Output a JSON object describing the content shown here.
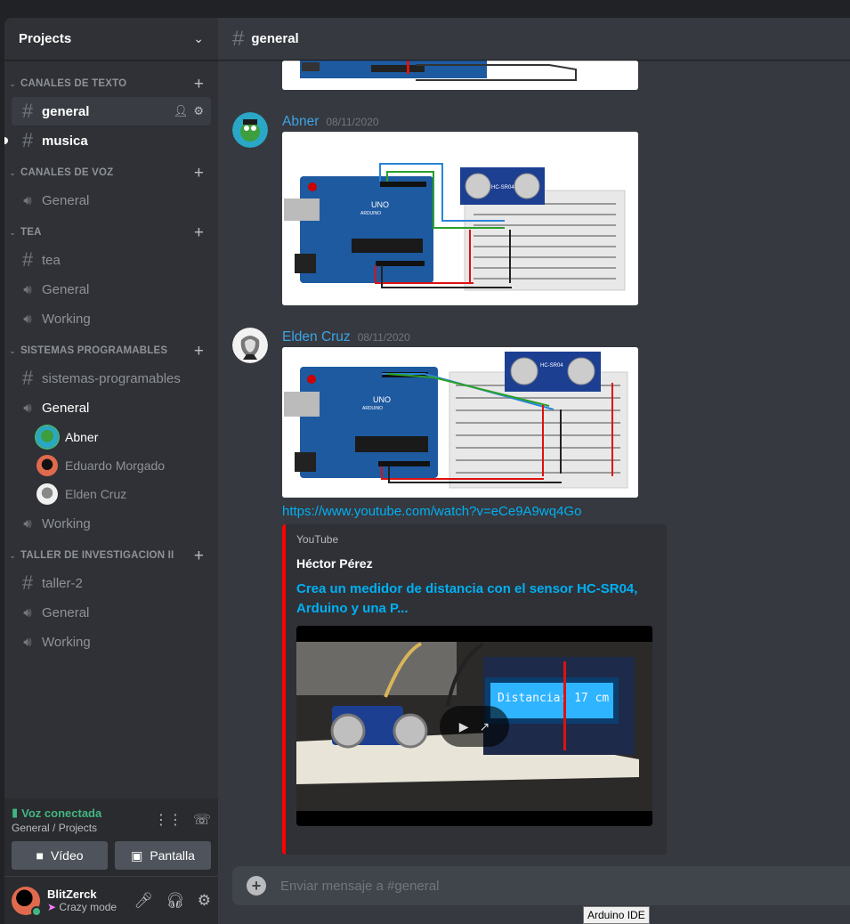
{
  "server": {
    "name": "Projects"
  },
  "categories": [
    {
      "label": "CANALES DE TEXTO",
      "channels": [
        {
          "name": "general",
          "type": "text",
          "state": "active"
        },
        {
          "name": "musica",
          "type": "text",
          "state": "unread"
        }
      ]
    },
    {
      "label": "CANALES DE VOZ",
      "channels": [
        {
          "name": "General",
          "type": "voice"
        }
      ]
    },
    {
      "label": "TEA",
      "channels": [
        {
          "name": "tea",
          "type": "text"
        },
        {
          "name": "General",
          "type": "voice"
        },
        {
          "name": "Working",
          "type": "voice"
        }
      ]
    },
    {
      "label": "SISTEMAS PROGRAMABLES",
      "channels": [
        {
          "name": "sistemas-programables",
          "type": "text"
        },
        {
          "name": "General",
          "type": "voice",
          "state": "connected",
          "users": [
            {
              "name": "Abner",
              "speaking": true
            },
            {
              "name": "Eduardo Morgado"
            },
            {
              "name": "Elden Cruz"
            }
          ]
        },
        {
          "name": "Working",
          "type": "voice"
        }
      ]
    },
    {
      "label": "TALLER DE INVESTIGACION II",
      "channels": [
        {
          "name": "taller-2",
          "type": "text"
        },
        {
          "name": "General",
          "type": "voice"
        },
        {
          "name": "Working",
          "type": "voice"
        }
      ]
    }
  ],
  "voice_panel": {
    "status": "Voz conectada",
    "location": "General / Projects",
    "video_label": "Vídeo",
    "screen_label": "Pantalla"
  },
  "user": {
    "name": "BlitZerck",
    "status": "Crazy mode"
  },
  "header": {
    "channel": "general"
  },
  "messages": [
    {
      "author": "Abner",
      "timestamp": "08/11/2020"
    },
    {
      "author": "Elden Cruz",
      "timestamp": "08/11/2020",
      "link": "https://www.youtube.com/watch?v=eCe9A9wq4Go"
    }
  ],
  "embed": {
    "provider": "YouTube",
    "author": "Héctor Pérez",
    "title": "Crea un medidor de distancia con el sensor HC-SR04, Arduino y una P...",
    "lcd_text": "Distancia: 17 cm"
  },
  "circuit_labels": {
    "sensor": "HC-SR04",
    "board": "UNO",
    "brand": "ARDUINO"
  },
  "composer": {
    "placeholder": "Enviar mensaje a #general"
  },
  "tooltip": "Arduino IDE",
  "colors": {
    "accent_link": "#00b0f4",
    "author": "#3ca4e6",
    "voice_green": "#43b581",
    "youtube_red": "#ff0000"
  }
}
